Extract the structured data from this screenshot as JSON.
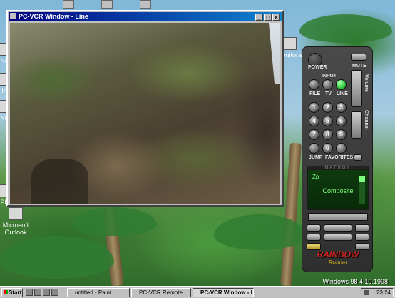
{
  "video_window": {
    "title": "PC-VCR Window - Line",
    "buttons": {
      "minimize": "_",
      "maximize": "□",
      "close": "×"
    }
  },
  "desktop": {
    "icons": [
      {
        "label": "Ne"
      },
      {
        "label": "In"
      },
      {
        "label": "Ne"
      },
      {
        "label": "Ph"
      },
      {
        "label": "Microsoft Outlook"
      },
      {
        "label": "monitor.ex"
      }
    ],
    "watermark": "Windows 98 4.10.1998"
  },
  "remote": {
    "power": "POWER",
    "mute": "MUTE",
    "input": "INPUT",
    "file": "FILE",
    "tv": "TV",
    "line": "LINE",
    "volume": "Volume",
    "channel": "Channel",
    "digits": [
      "1",
      "2",
      "3",
      "4",
      "5",
      "6",
      "7",
      "8",
      "9",
      "0"
    ],
    "jump": "JUMP",
    "favorites": "FAVORITES",
    "brand_bar": "MATROX",
    "lcd_mode": "Composite",
    "lcd_top": "Zp",
    "logo": "RAINBOW",
    "logo_sub": "Runner",
    "colors": {
      "body": "#3a3a3a",
      "lcd_text": "#7cff7c",
      "line_led": "#2ecc40",
      "logo": "#c82020"
    }
  },
  "taskbar": {
    "start": "Start",
    "tasks": [
      {
        "label": "untitled - Paint"
      },
      {
        "label": "PC-VCR Remote"
      },
      {
        "label": "PC-VCR Window - Line"
      }
    ],
    "clock": "23:24"
  }
}
